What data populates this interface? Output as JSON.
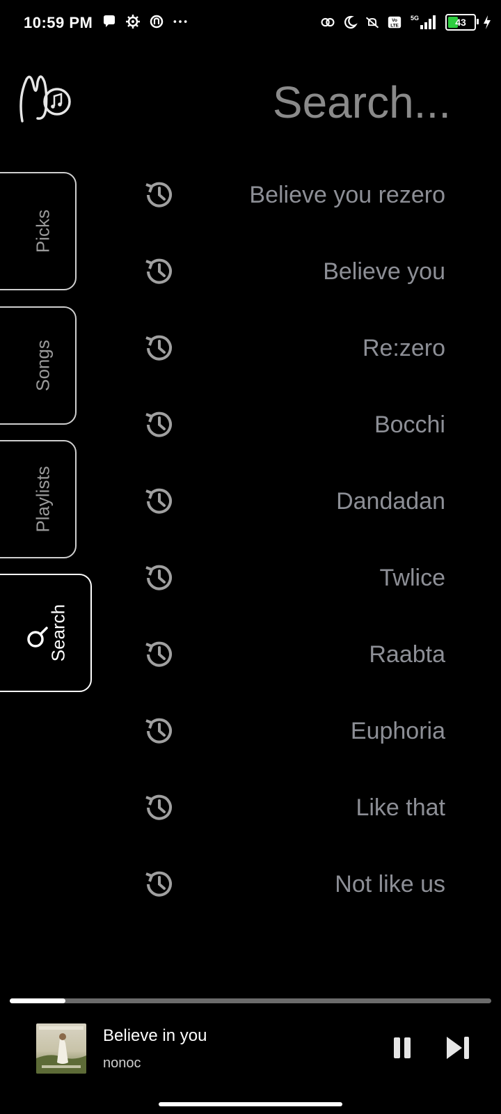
{
  "status_bar": {
    "time": "10:59 PM",
    "left_icons": [
      "chat-bubble-icon",
      "gear-icon",
      "app-icon",
      "more-dots-icon"
    ],
    "right_icons": [
      "sync-icon",
      "moon-icon",
      "mute-icon",
      "volte-icon",
      "signal-icon"
    ],
    "network": "5G",
    "battery": "43",
    "charging": true
  },
  "header": {
    "search_title": "Search..."
  },
  "tabs": [
    {
      "label": "Picks",
      "active": false
    },
    {
      "label": "Songs",
      "active": false
    },
    {
      "label": "Playlists",
      "active": false
    },
    {
      "label": "Search",
      "active": true
    }
  ],
  "history": [
    "Believe you rezero",
    "Believe you",
    "Re:zero",
    "Bocchi",
    "Dandadan",
    "Twlice",
    "Raabta",
    "Euphoria",
    "Like that",
    "Not like us"
  ],
  "player": {
    "title": "Believe in you",
    "artist": "nonoc",
    "progress": 0.115
  },
  "colors": {
    "background": "#000000",
    "muted_text": "#8d8f96",
    "border": "#cfcfcf",
    "battery_fill": "#2ecc40"
  }
}
